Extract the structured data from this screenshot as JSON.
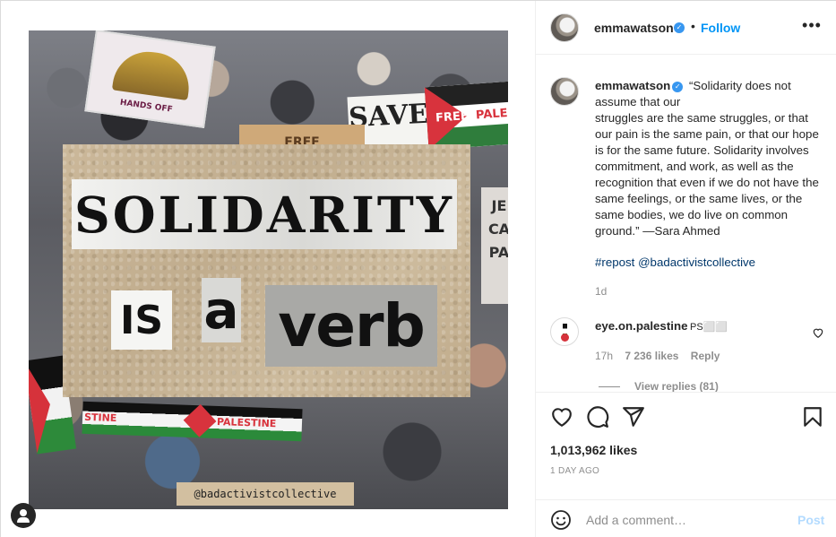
{
  "post": {
    "watermark": "@badactivistcollective",
    "image_words": {
      "line1": "SOLIDARITY",
      "is": "IS",
      "a": "a",
      "verb": "verb"
    },
    "signs": {
      "dome_sign": "HANDS OFF",
      "save_sign": "SAVE",
      "free_sign_left": "FREE",
      "free_sign_right": "PALES",
      "cardboard_sign": "FREE",
      "side_sign": "JE CA PA",
      "banner_left": "STINE",
      "banner_right": "PALESTINE"
    }
  },
  "header": {
    "username": "emmawatson",
    "separator": "•",
    "follow_label": "Follow",
    "more_label": "•••"
  },
  "caption": {
    "username": "emmawatson",
    "text": "“Solidarity does not assume that our\nstruggles are the same struggles, or that our pain is the same pain, or that our hope is for the same future. Solidarity involves commitment, and work, as well as the recognition that even if we do not have the same feelings, or the same lives, or the same bodies, we do live on common ground.” —Sara Ahmed",
    "hashtag": "#repost",
    "mention": "@badactivistcollective",
    "age": "1d"
  },
  "reply": {
    "username": "eye.on.palestine",
    "suffix": "PS⬜⬜",
    "age": "17h",
    "likes": "7 236 likes",
    "reply_label": "Reply",
    "view_replies": "View replies (81)"
  },
  "footer": {
    "likes": "1,013,962 likes",
    "date": "1 DAY AGO",
    "comment_placeholder": "Add a comment…",
    "post_label": "Post"
  },
  "colors": {
    "accent": "#0095f6",
    "verified": "#3897f0",
    "post_disabled": "#b3dbff",
    "muted": "#8e8e8e",
    "link": "#00376b"
  }
}
